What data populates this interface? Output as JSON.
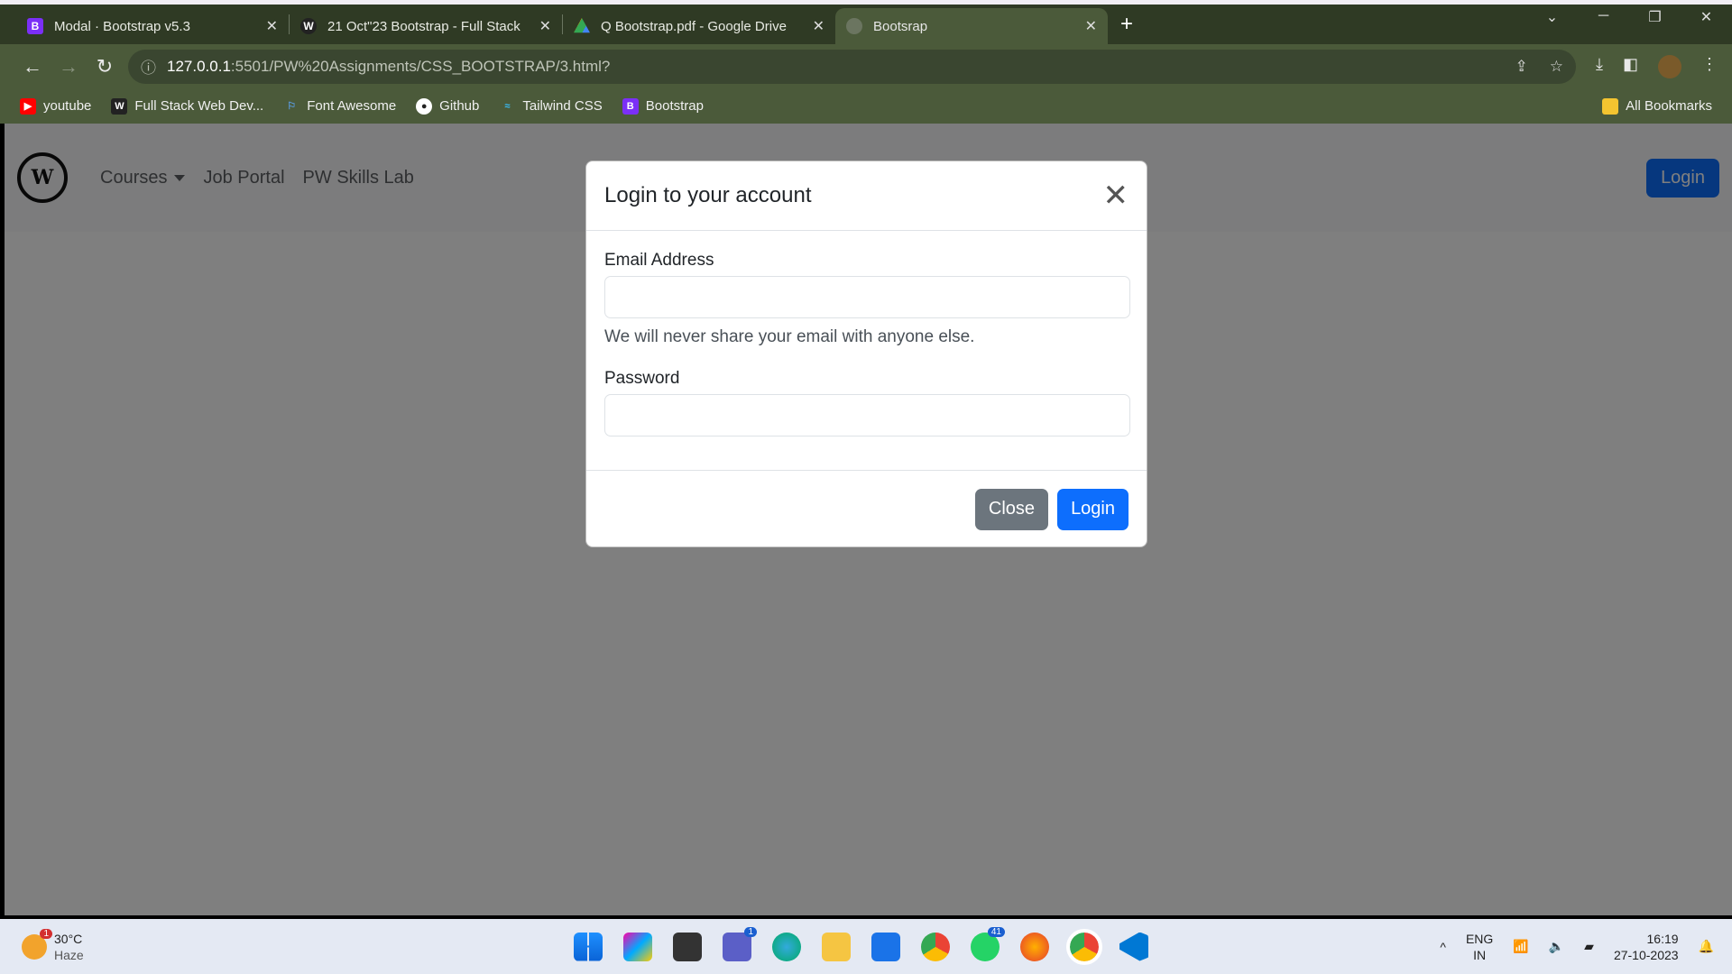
{
  "browser": {
    "tabs": [
      {
        "title": "Modal · Bootstrap v5.3",
        "icon": "bootstrap-icon"
      },
      {
        "title": "21 Oct\"23 Bootstrap - Full Stack",
        "icon": "pw-icon"
      },
      {
        "title": "Q Bootstrap.pdf - Google Drive",
        "icon": "google-drive-icon"
      },
      {
        "title": "Bootsrap",
        "icon": "globe-icon"
      }
    ],
    "url_host": "127.0.0.1",
    "url_path": ":5501/PW%20Assignments/CSS_BOOTSTRAP/3.html?",
    "bookmarks": [
      "youtube",
      "Full Stack Web Dev...",
      "Font Awesome",
      "Github",
      "Tailwind CSS",
      "Bootstrap"
    ],
    "all_bookmarks": "All Bookmarks"
  },
  "navbar": {
    "logo": "PW",
    "links": [
      "Courses",
      "Job Portal",
      "PW Skills Lab"
    ],
    "login": "Login"
  },
  "modal": {
    "title": "Login to your account",
    "email_label": "Email Address",
    "email_help": "We will never share your email with anyone else.",
    "password_label": "Password",
    "close_label": "Close",
    "login_label": "Login"
  },
  "taskbar": {
    "temp": "30°C",
    "weather": "Haze",
    "weather_badge": "1",
    "teams_badge": "1",
    "whatsapp_badge": "41",
    "lang": "ENG",
    "region": "IN",
    "time": "16:19",
    "date": "27-10-2023"
  }
}
